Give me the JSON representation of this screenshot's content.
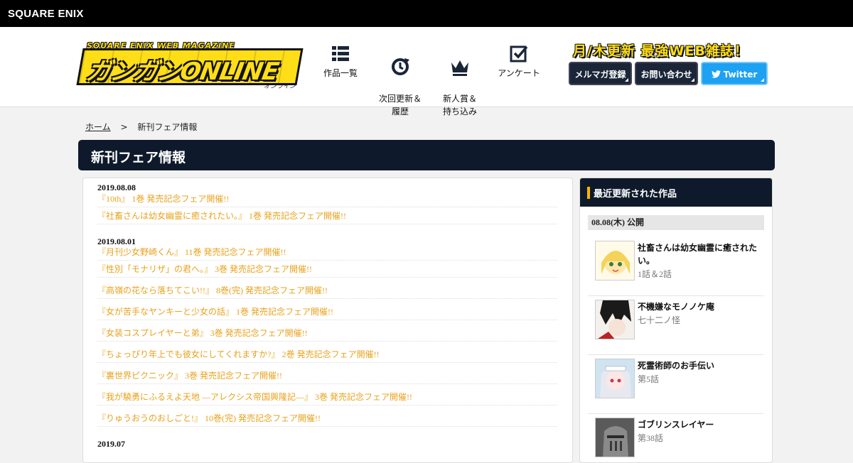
{
  "topbar": {
    "brand": "SQUARE ENIX"
  },
  "logo": {
    "top_text": "SQUARE ENIX WEB MAGAZINE",
    "main_text": "ガンガンONLINE",
    "sub_text": "オンライン"
  },
  "nav": [
    {
      "label": "作品一覧",
      "icon": "grid-list-icon"
    },
    {
      "label": "次回更新＆\n履歴",
      "icon": "refresh-clock-icon"
    },
    {
      "label": "新人賞＆\n持ち込み",
      "icon": "crown-icon"
    },
    {
      "label": "アンケート",
      "icon": "checkbox-icon"
    }
  ],
  "tagline": "月/木更新 最強WEB雑誌！",
  "header_buttons": {
    "mail": "メルマガ登録",
    "contact": "お問い合わせ",
    "twitter": "Twitter"
  },
  "breadcrumb": {
    "home": "ホーム",
    "separator": ">",
    "current": "新刊フェア情報"
  },
  "page_title": "新刊フェア情報",
  "news_groups": [
    {
      "date": "2019.08.08",
      "items": [
        "『10th』 1巻 発売記念フェア開催!!",
        "『社畜さんは幼女幽霊に癒されたい。』 1巻 発売記念フェア開催!!"
      ]
    },
    {
      "date": "2019.08.01",
      "items": [
        "『月刊少女野崎くん』 11巻 発売記念フェア開催!!",
        "『性別「モナリザ」の君へ。』 3巻 発売記念フェア開催!!",
        "『高嶺の花なら落ちてこい!!』 8巻(完) 発売記念フェア開催!!",
        "『女が苦手なヤンキーと少女の話』 1巻 発売記念フェア開催!!",
        "『女装コスプレイヤーと弟』 3巻 発売記念フェア開催!!",
        "『ちょっぴり年上でも彼女にしてくれますか?』 2巻 発売記念フェア開催!!",
        "『裏世界ピクニック』 3巻 発売記念フェア開催!!",
        "『我が驍勇にふるえよ天地 —アレクシス帝国興隆記—』 3巻 発売記念フェア開催!!",
        "『りゅうおうのおしごと!』 10巻(完) 発売記念フェア開催!!"
      ]
    },
    {
      "date": "2019.07",
      "items": []
    }
  ],
  "sidebar": {
    "heading": "最近更新された作品",
    "date_label": "08.08(木) 公開",
    "works": [
      {
        "title": "社畜さんは幼女幽霊に癒されたい。",
        "episode": "1話＆2話"
      },
      {
        "title": "不機嫌なモノノケ庵",
        "episode": "七十二ノ怪"
      },
      {
        "title": "死霊術師のお手伝い",
        "episode": "第5話"
      },
      {
        "title": "ゴブリンスレイヤー",
        "episode": "第38話"
      }
    ]
  },
  "colors": {
    "navy": "#0e1a2b",
    "accent_yellow": "#ffde17",
    "link_orange": "#e8a21e",
    "twitter_blue": "#1da1f2"
  }
}
